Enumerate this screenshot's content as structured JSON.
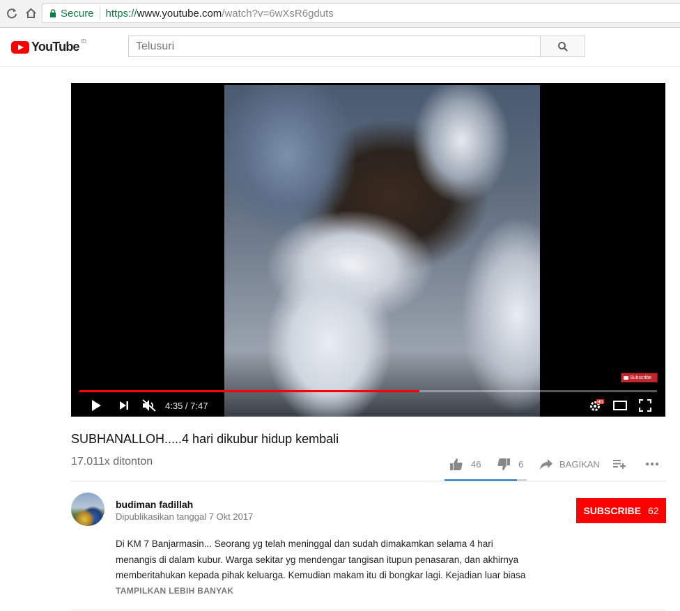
{
  "browser": {
    "secure_label": "Secure",
    "url_scheme": "https://",
    "url_host": "www.youtube.com",
    "url_path": "/watch?v=6wXsR6gduts"
  },
  "header": {
    "logo_text": "YouTube",
    "region": "ID",
    "search_placeholder": "Telusuri"
  },
  "player": {
    "time_display": "4:35 / 7:47",
    "watermark_label": "Subscribe",
    "progress_fraction": 0.589,
    "hd_badge": "HD"
  },
  "video": {
    "title": "SUBHANALLOH.....4 hari dikubur hidup kembali",
    "views": "17.011x ditonton",
    "likes": "46",
    "dislikes": "6",
    "like_ratio": 0.88,
    "share_label": "BAGIKAN"
  },
  "owner": {
    "channel_name": "budiman fadillah",
    "published": "Dipublikasikan tanggal 7 Okt 2017",
    "subscribe_label": "SUBSCRIBE",
    "subscriber_count": "62"
  },
  "description": {
    "lines": [
      "Di KM 7 Banjarmasin... Seorang yg telah meninggal dan sudah dimakamkan selama 4 hari",
      "menangis di dalam kubur. Warga sekitar yg mendengar tangisan itupun penasaran, dan akhirnya",
      "memberitahukan kepada pihak keluarga. Kemudian makam itu di bongkar lagi. Kejadian luar biasa"
    ],
    "show_more_label": "TAMPILKAN LEBIH BANYAK"
  },
  "colors": {
    "brand_red": "#ff0000",
    "secure_green": "#0b8043",
    "sentiment_blue": "#167ac6"
  }
}
